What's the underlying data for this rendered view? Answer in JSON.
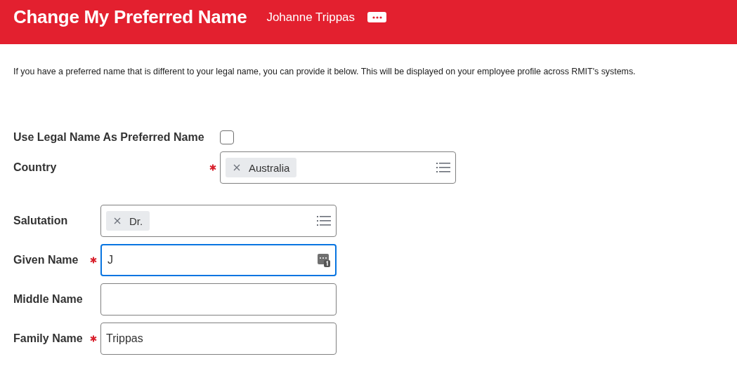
{
  "header": {
    "title": "Change My Preferred Name",
    "user_name": "Johanne Trippas"
  },
  "intro": "If you have a preferred name that is different to your legal name, you can provide it below. This will be displayed on your employee profile across RMIT's systems.",
  "legal_name_option": {
    "label": "Use Legal Name As Preferred Name",
    "checked": false
  },
  "country": {
    "kind": "select",
    "label": "Country",
    "required": true,
    "chips": [
      "Australia"
    ],
    "focused": false
  },
  "name_fields": [
    {
      "kind": "select",
      "label": "Salutation",
      "required": false,
      "chips": [
        "Dr."
      ],
      "focused": false
    },
    {
      "kind": "text",
      "label": "Given Name",
      "required": true,
      "value": "J",
      "focused": true
    },
    {
      "kind": "text",
      "label": "Middle Name",
      "required": false,
      "focused": false
    },
    {
      "kind": "text",
      "label": "Family Name",
      "required": true,
      "value": "Trippas",
      "focused": false
    }
  ]
}
